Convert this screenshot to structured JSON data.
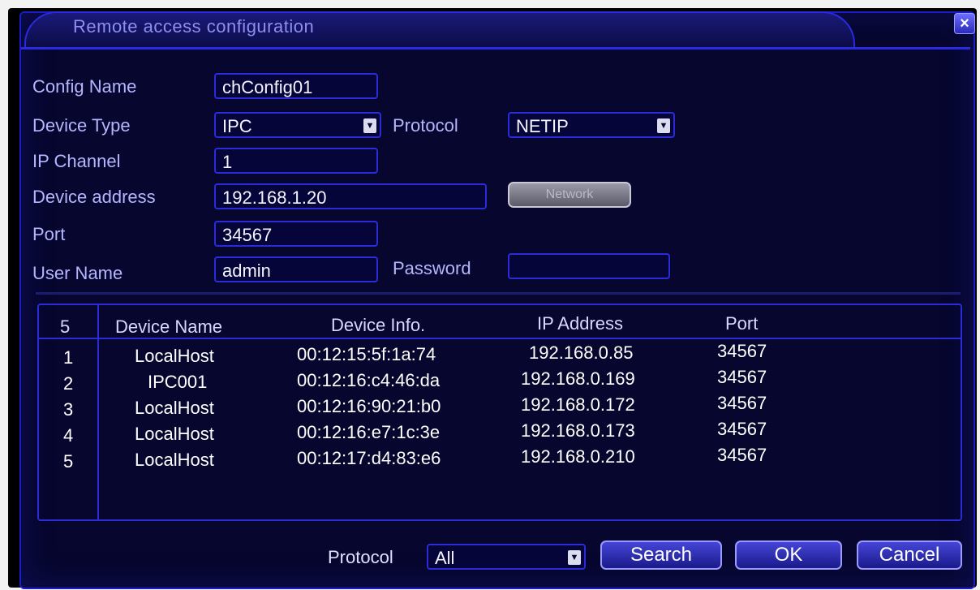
{
  "window": {
    "title": "Remote access configuration",
    "close_label": "×"
  },
  "form": {
    "config_name": {
      "label": "Config Name",
      "value": "chConfig01"
    },
    "device_type": {
      "label": "Device Type",
      "value": "IPC"
    },
    "protocol": {
      "label": "Protocol",
      "value": "NETIP"
    },
    "ip_channel": {
      "label": "IP Channel",
      "value": "1"
    },
    "device_address": {
      "label": "Device address",
      "value": "192.168.1.20"
    },
    "network_button": "Network",
    "port": {
      "label": "Port",
      "value": "34567"
    },
    "user_name": {
      "label": "User Name",
      "value": "admin"
    },
    "password": {
      "label": "Password",
      "value": ""
    }
  },
  "table": {
    "headers": [
      "5",
      "Device Name",
      "Device Info.",
      "IP Address",
      "Port"
    ],
    "rows": [
      [
        "1",
        "LocalHost",
        "00:12:15:5f:1a:74",
        "192.168.0.85",
        "34567"
      ],
      [
        "2",
        "IPC001",
        "00:12:16:c4:46:da",
        "192.168.0.169",
        "34567"
      ],
      [
        "3",
        "LocalHost",
        "00:12:16:90:21:b0",
        "192.168.0.172",
        "34567"
      ],
      [
        "4",
        "LocalHost",
        "00:12:16:e7:1c:3e",
        "192.168.0.173",
        "34567"
      ],
      [
        "5",
        "LocalHost",
        "00:12:17:d4:83:e6",
        "192.168.0.210",
        "34567"
      ]
    ]
  },
  "footer": {
    "protocol_label": "Protocol",
    "protocol_value": "All",
    "search_label": "Search",
    "ok_label": "OK",
    "cancel_label": "Cancel"
  }
}
